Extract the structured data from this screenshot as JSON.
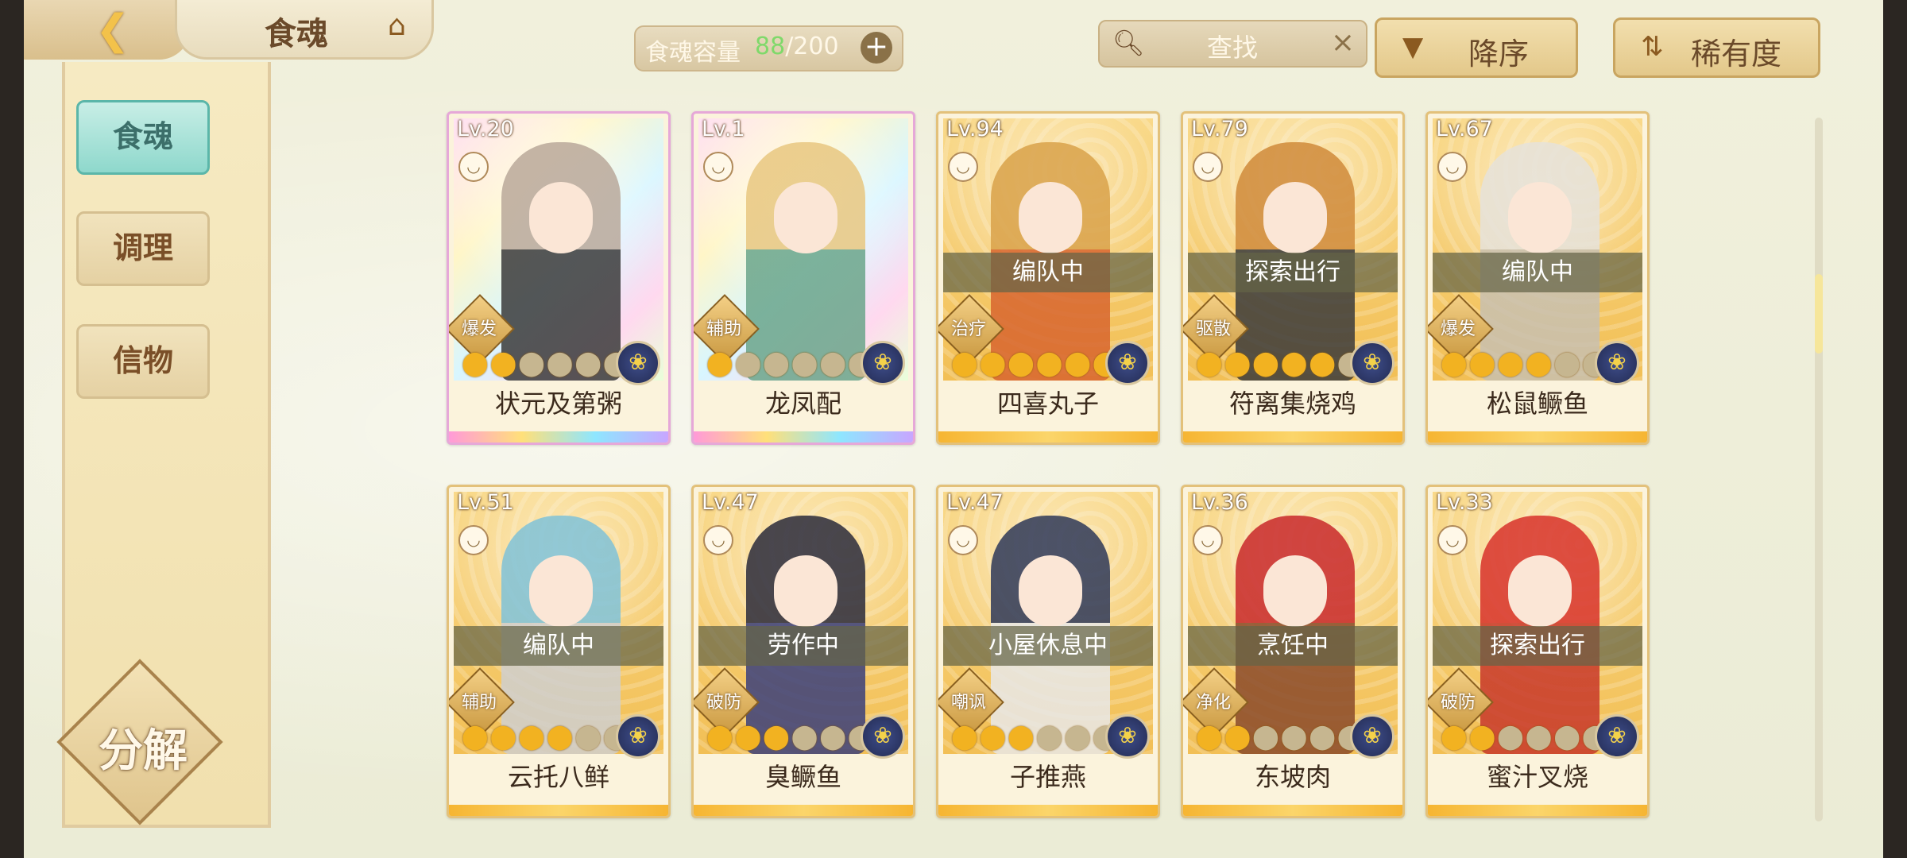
{
  "header": {
    "title": "食魂",
    "back_icon": "back-arrow-icon",
    "home_icon": "pavilion-icon",
    "capacity_label": "食魂容量",
    "capacity_current": "88",
    "capacity_max": "/200",
    "capacity_add": "+",
    "search_placeholder": "查找",
    "search_clear": "×",
    "sort_order_label": "降序",
    "sort_order_icon": "▼",
    "sort_key_label": "稀有度",
    "sort_key_icon": "⇅"
  },
  "sidebar": {
    "items": [
      {
        "label": "食魂",
        "active": true
      },
      {
        "label": "调理",
        "active": false
      },
      {
        "label": "信物",
        "active": false
      }
    ],
    "decompose_label": "分解"
  },
  "cards": [
    {
      "level": "Lv.20",
      "name": "状元及第粥",
      "role": "爆发",
      "status": "",
      "stars": 2,
      "rarity": "rainbow",
      "hair": "#b9a89a",
      "robe": "#3a3a3a"
    },
    {
      "level": "Lv.1",
      "name": "龙凤配",
      "role": "辅助",
      "status": "",
      "stars": 1,
      "rarity": "rainbow",
      "hair": "#e8c780",
      "robe": "#6aa58a"
    },
    {
      "level": "Lv.94",
      "name": "四喜丸子",
      "role": "治疗",
      "status": "编队中",
      "stars": 6,
      "rarity": "gold",
      "hair": "#d9a24a",
      "robe": "#d8652e"
    },
    {
      "level": "Lv.79",
      "name": "符离集烧鸡",
      "role": "驱散",
      "status": "探索出行",
      "stars": 5,
      "rarity": "gold",
      "hair": "#d08a3a",
      "robe": "#3a3a3a"
    },
    {
      "level": "Lv.67",
      "name": "松鼠鳜鱼",
      "role": "爆发",
      "status": "编队中",
      "stars": 4,
      "rarity": "gold",
      "hair": "#e6e2da",
      "robe": "#c8c0b0"
    },
    {
      "level": "Lv.51",
      "name": "云托八鲜",
      "role": "辅助",
      "status": "编队中",
      "stars": 4,
      "rarity": "gold",
      "hair": "#7fc2d8",
      "robe": "#cfcfcf"
    },
    {
      "level": "Lv.47",
      "name": "臭鳜鱼",
      "role": "破防",
      "status": "劳作中",
      "stars": 3,
      "rarity": "gold",
      "hair": "#2a2a3a",
      "robe": "#3a3f7a"
    },
    {
      "level": "Lv.47",
      "name": "子推燕",
      "role": "嘲讽",
      "status": "小屋休息中",
      "stars": 3,
      "rarity": "gold",
      "hair": "#2e3858",
      "robe": "#e8e8e8"
    },
    {
      "level": "Lv.36",
      "name": "东坡肉",
      "role": "净化",
      "status": "烹饪中",
      "stars": 2,
      "rarity": "gold",
      "hair": "#c8282a",
      "robe": "#8a4a2a"
    },
    {
      "level": "Lv.33",
      "name": "蜜汁叉烧",
      "role": "破防",
      "status": "探索出行",
      "stars": 2,
      "rarity": "gold",
      "hair": "#d8322a",
      "robe": "#c8382a"
    }
  ],
  "colors": {
    "accent_teal": "#8ed8cc",
    "gold_frame": "#e3c17a",
    "element_badge": "#2f3a6e"
  }
}
